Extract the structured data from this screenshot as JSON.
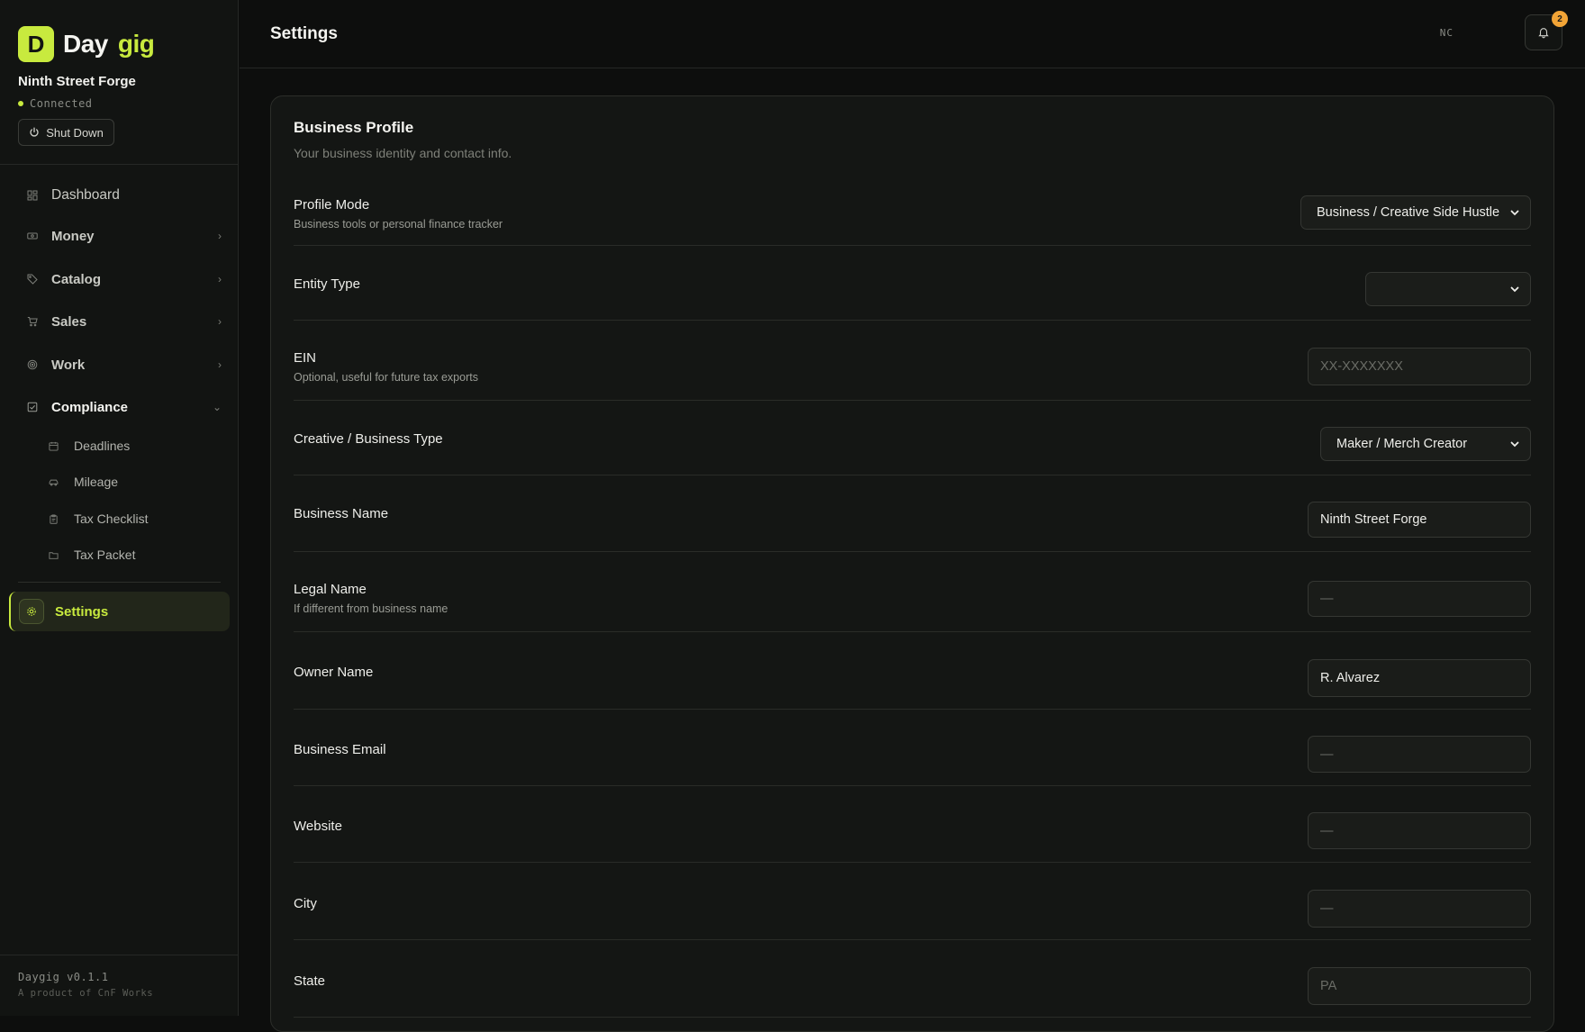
{
  "brand": {
    "logo_letter": "D",
    "name_part1": "Day",
    "name_part2": "gig",
    "accent": "#c8ea3e"
  },
  "workspace": {
    "name": "Ninth Street Forge",
    "status": "Connected",
    "shutdown_label": "Shut Down"
  },
  "nav": {
    "dashboard": "Dashboard",
    "money": "Money",
    "catalog": "Catalog",
    "sales": "Sales",
    "work": "Work",
    "compliance": "Compliance",
    "compliance_items": [
      "Deadlines",
      "Mileage",
      "Tax Checklist",
      "Tax Packet"
    ],
    "settings": "Settings"
  },
  "footer": {
    "version": "Daygig v0.1.1",
    "credit": "A product of CnF Works"
  },
  "header": {
    "title": "Settings",
    "initials": "NC",
    "notification_count": "2",
    "badge_color": "#f2a436"
  },
  "profile": {
    "title": "Business Profile",
    "subtitle": "Your business identity and contact info.",
    "profile_mode": {
      "label": "Profile Mode",
      "hint": "Business tools or personal finance tracker",
      "value": "Business / Creative Side Hustle"
    },
    "entity_type": {
      "label": "Entity Type",
      "value": ""
    },
    "ein": {
      "label": "EIN",
      "hint": "Optional, useful for future tax exports",
      "placeholder": "XX-XXXXXXX",
      "value": ""
    },
    "business_type": {
      "label": "Creative / Business Type",
      "value": "Maker / Merch Creator"
    },
    "business_name": {
      "label": "Business Name",
      "value": "Ninth Street Forge"
    },
    "legal_name": {
      "label": "Legal Name",
      "hint": "If different from business name",
      "placeholder": "—",
      "value": ""
    },
    "owner_name": {
      "label": "Owner Name",
      "value": "R. Alvarez"
    },
    "business_email": {
      "label": "Business Email",
      "placeholder": "—",
      "value": ""
    },
    "website": {
      "label": "Website",
      "placeholder": "—",
      "value": ""
    },
    "city": {
      "label": "City",
      "placeholder": "—",
      "value": ""
    },
    "state": {
      "label": "State",
      "placeholder": "PA",
      "value": ""
    }
  }
}
